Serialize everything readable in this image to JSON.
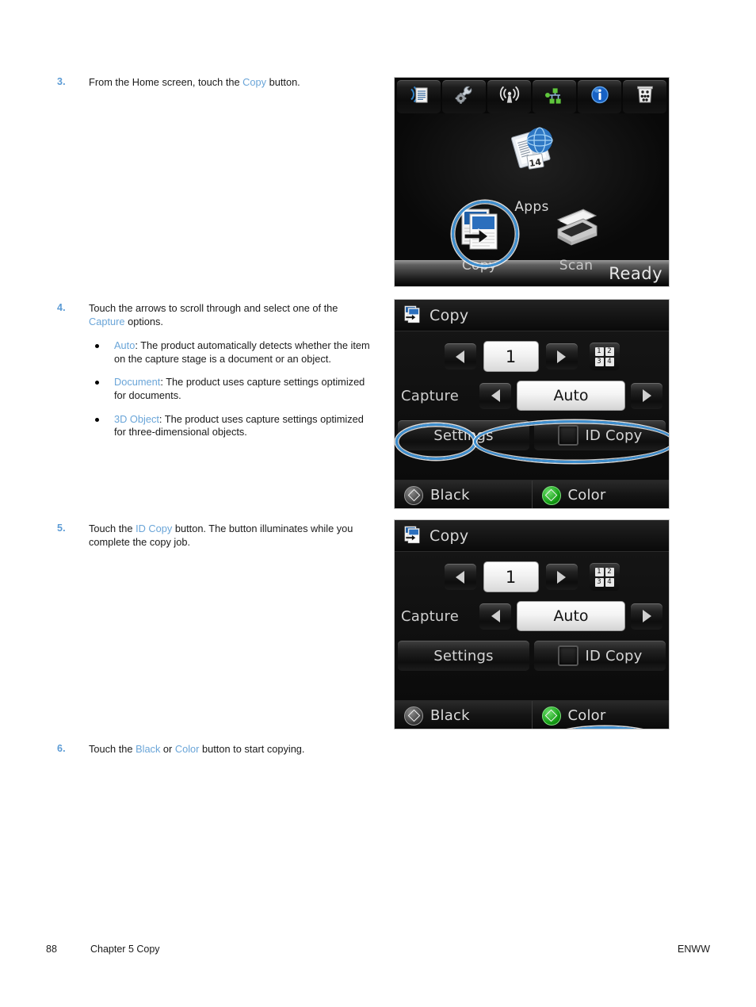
{
  "doc": {
    "steps": [
      {
        "number": "3.",
        "text_before": "From the Home screen, touch the ",
        "link": "Copy",
        "text_after": " button."
      },
      {
        "number": "4.",
        "text_before": "Touch the arrows to scroll through and select one of the ",
        "link": "Capture",
        "text_after": " options.",
        "bullets": [
          {
            "link": "Auto",
            "text": ": The product automatically detects whether the item on the capture stage is a document or an object."
          },
          {
            "link": "Document",
            "text": ": The product uses capture settings optimized for documents."
          },
          {
            "link": "3D Object",
            "text": ": The product uses capture settings optimized for three-dimensional objects."
          }
        ]
      },
      {
        "number": "5.",
        "text_before": "Touch the ",
        "link": "ID Copy",
        "text_after": " button. The button illuminates while you complete the copy job."
      },
      {
        "number": "6.",
        "text_before": "Touch the ",
        "link": "Black",
        "text_mid": " or ",
        "link2": "Color",
        "text_after": " button to start copying."
      }
    ],
    "footer": {
      "page_number": "88",
      "chapter": "Chapter 5   Copy",
      "right": "ENWW"
    },
    "colors": {
      "link_blue": "#6aa5d8",
      "step_number_blue": "#5b9bd5",
      "highlight_blue": "#3e8fd0"
    }
  },
  "home_screen": {
    "toolbar_icons": [
      "web-services-icon",
      "setup-wrench-gear-icon",
      "wireless-icon",
      "network-icon",
      "information-icon",
      "supplies-levels-icon"
    ],
    "apps_label": "Apps",
    "apps_icon": "apps-newspaper-globe-icon",
    "tiles": [
      {
        "label": "Copy",
        "icon": "copy-icon",
        "highlighted": true
      },
      {
        "label": "Scan",
        "icon": "scanner-icon",
        "highlighted": false
      }
    ],
    "status": "Ready"
  },
  "copy_screen": {
    "title": "Copy",
    "title_icon": "copy-icon",
    "copies_value": "1",
    "left_arrow": "left-arrow-icon",
    "right_arrow": "right-arrow-icon",
    "collate_icon": "collate-icon",
    "collate_cells": [
      "1",
      "2",
      "3",
      "4"
    ],
    "capture_label": "Capture",
    "capture_value": "Auto",
    "settings_label": "Settings",
    "id_copy_label": "ID Copy",
    "black_label": "Black",
    "color_label": "Color",
    "highlight": "capture"
  },
  "idcopy_screen": {
    "title": "Copy",
    "title_icon": "copy-icon",
    "copies_value": "1",
    "collate_cells": [
      "1",
      "2",
      "3",
      "4"
    ],
    "capture_label": "Capture",
    "capture_value": "Auto",
    "settings_label": "Settings",
    "id_copy_label": "ID Copy",
    "black_label": "Black",
    "color_label": "Color",
    "highlight": "id-copy"
  }
}
